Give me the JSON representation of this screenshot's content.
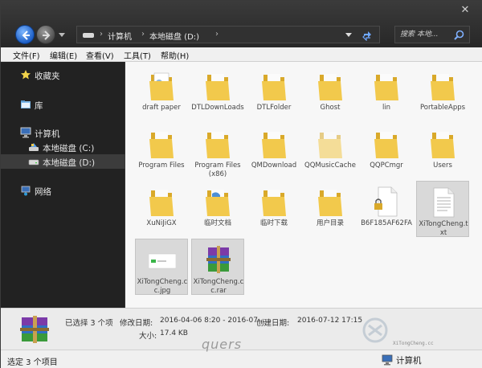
{
  "window": {
    "close_glyph": "✕"
  },
  "address": {
    "crumbs": [
      "计算机",
      "本地磁盘 (D:)"
    ],
    "separator": "›",
    "trailing_separator": "›"
  },
  "search": {
    "placeholder": "搜索 本地..."
  },
  "menu": [
    "文件(F)",
    "编辑(E)",
    "查看(V)",
    "工具(T)",
    "帮助(H)"
  ],
  "sidebar": {
    "favorites": "收藏夹",
    "library": "库",
    "computer": "计算机",
    "drive_c": "本地磁盘 (C:)",
    "drive_d": "本地磁盘 (D:)",
    "network": "网络"
  },
  "files": [
    {
      "name": "draft paper",
      "icon": "folder-document-icon",
      "selected": false
    },
    {
      "name": "DTLDownLoads",
      "icon": "folder-icon",
      "selected": false
    },
    {
      "name": "DTLFolder",
      "icon": "folder-icon",
      "selected": false
    },
    {
      "name": "Ghost",
      "icon": "folder-icon",
      "selected": false
    },
    {
      "name": "lin",
      "icon": "folder-icon",
      "selected": false
    },
    {
      "name": "PortableApps",
      "icon": "folder-icon",
      "selected": false
    },
    {
      "name": "Program Files",
      "icon": "folder-icon",
      "selected": false
    },
    {
      "name": "Program Files (x86)",
      "icon": "folder-icon",
      "selected": false
    },
    {
      "name": "QMDownload",
      "icon": "folder-icon",
      "selected": false
    },
    {
      "name": "QQMusicCache",
      "icon": "folder-faded-icon",
      "selected": false
    },
    {
      "name": "QQPCmgr",
      "icon": "folder-icon",
      "selected": false
    },
    {
      "name": "Users",
      "icon": "folder-icon",
      "selected": false
    },
    {
      "name": "XuNiJiGX",
      "icon": "folder-icon",
      "selected": false
    },
    {
      "name": "临时文档",
      "icon": "folder-icon",
      "selected": false
    },
    {
      "name": "临时下载",
      "icon": "folder-icon",
      "selected": false
    },
    {
      "name": "用户目录",
      "icon": "folder-icon",
      "selected": false
    },
    {
      "name": "B6F185AF62FA",
      "icon": "locked-file-icon",
      "selected": false
    },
    {
      "name": "XiTongCheng.txt",
      "icon": "text-file-icon",
      "selected": true
    },
    {
      "name": "XiTongCheng.cc.jpg",
      "icon": "image-file-icon",
      "selected": true
    },
    {
      "name": "XiTongCheng.cc.rar",
      "icon": "rar-archive-icon",
      "selected": true
    }
  ],
  "details": {
    "selected_count": "已选择 3 个项",
    "modified_label": "修改日期:",
    "modified_value": "2016-04-06 8:20 - 2016-07-...",
    "created_label": "创建日期:",
    "created_value": "2016-07-12 17:15",
    "size_label": "大小:",
    "size_value": "17.4 KB"
  },
  "status": {
    "left": "选定 3 个项目",
    "right": "计算机"
  },
  "watermark": {
    "quers": "quers",
    "url": "XiTongCheng.cc"
  },
  "colors": {
    "folder": "#f2c94c",
    "folder_dark": "#d9a92a",
    "accent_blue": "#1d5fc7"
  }
}
